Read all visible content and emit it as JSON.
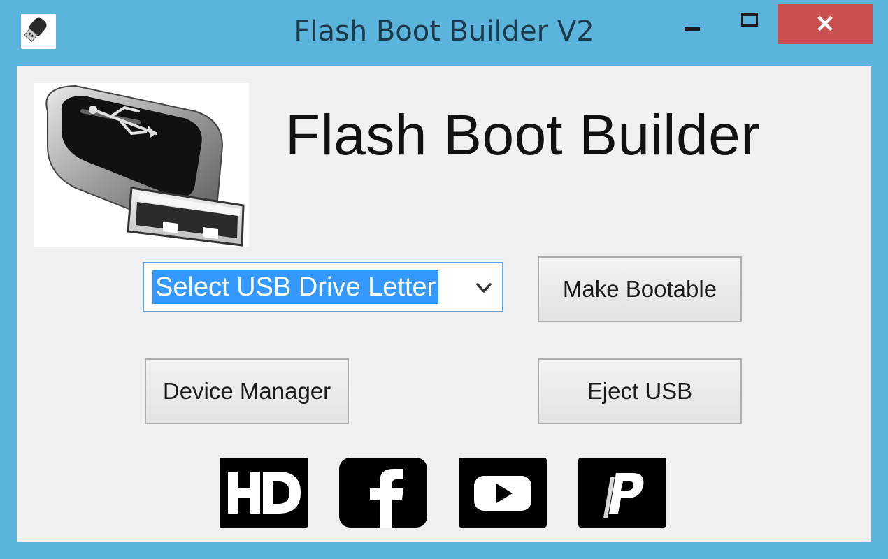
{
  "window": {
    "title": "Flash Boot Builder V2",
    "close_glyph": "✕"
  },
  "main": {
    "heading": "Flash Boot Builder",
    "drive_select": {
      "value": "Select USB Drive Letter"
    },
    "buttons": {
      "make_bootable": "Make Bootable",
      "device_manager": "Device Manager",
      "eject_usb": "Eject USB"
    },
    "social_icons": [
      "hd-logo-icon",
      "facebook-icon",
      "youtube-icon",
      "paypal-icon"
    ]
  },
  "colors": {
    "window_frame": "#5bb4dc",
    "close_button": "#c9504f",
    "selection_highlight": "#3399ff"
  }
}
